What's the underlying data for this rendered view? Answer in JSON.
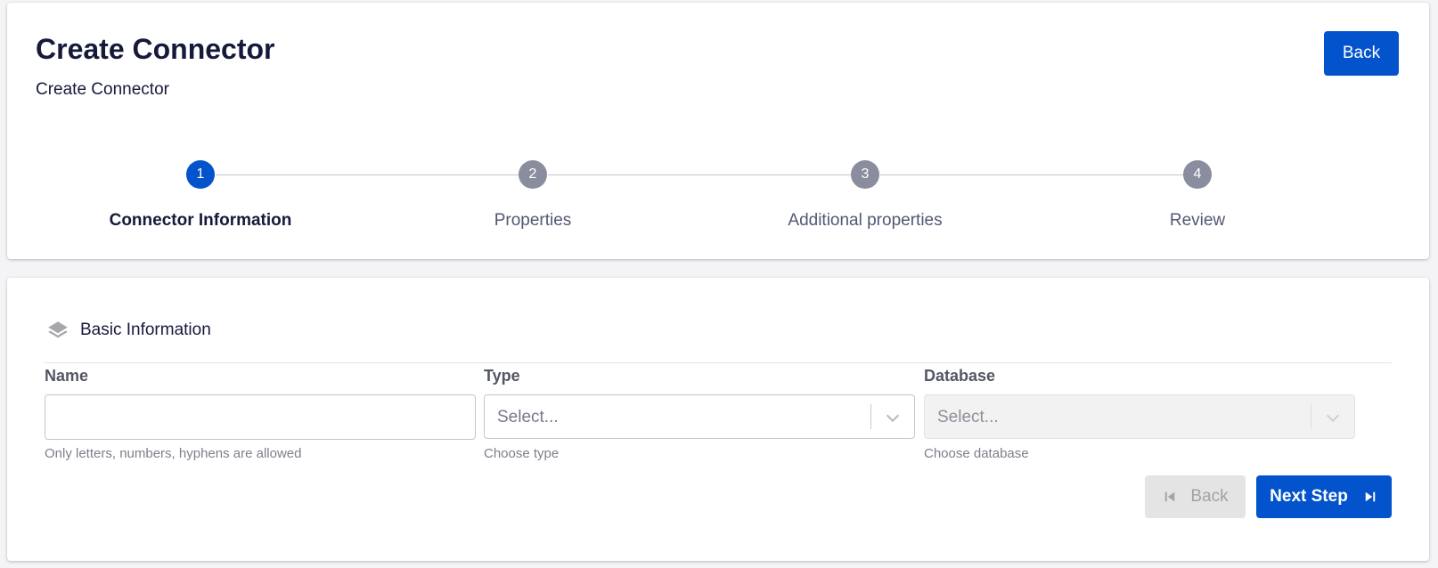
{
  "header": {
    "title": "Create Connector",
    "subtitle": "Create Connector",
    "back_label": "Back"
  },
  "stepper": {
    "current_step": 1,
    "steps": [
      {
        "number": "1",
        "label": "Connector Information"
      },
      {
        "number": "2",
        "label": "Properties"
      },
      {
        "number": "3",
        "label": "Additional properties"
      },
      {
        "number": "4",
        "label": "Review"
      }
    ]
  },
  "basic_info": {
    "section_title": "Basic Information",
    "icon": "layers-icon",
    "name": {
      "label": "Name",
      "value": "",
      "helper": "Only letters, numbers, hyphens are allowed"
    },
    "type": {
      "label": "Type",
      "placeholder": "Select...",
      "helper": "Choose type"
    },
    "database": {
      "label": "Database",
      "placeholder": "Select...",
      "helper": "Choose database",
      "disabled": true
    }
  },
  "actions": {
    "back_label": "Back",
    "next_label": "Next Step"
  },
  "colors": {
    "primary": "#0353cc",
    "step_inactive": "#8a8d9e",
    "text_dark": "#151a3a"
  }
}
